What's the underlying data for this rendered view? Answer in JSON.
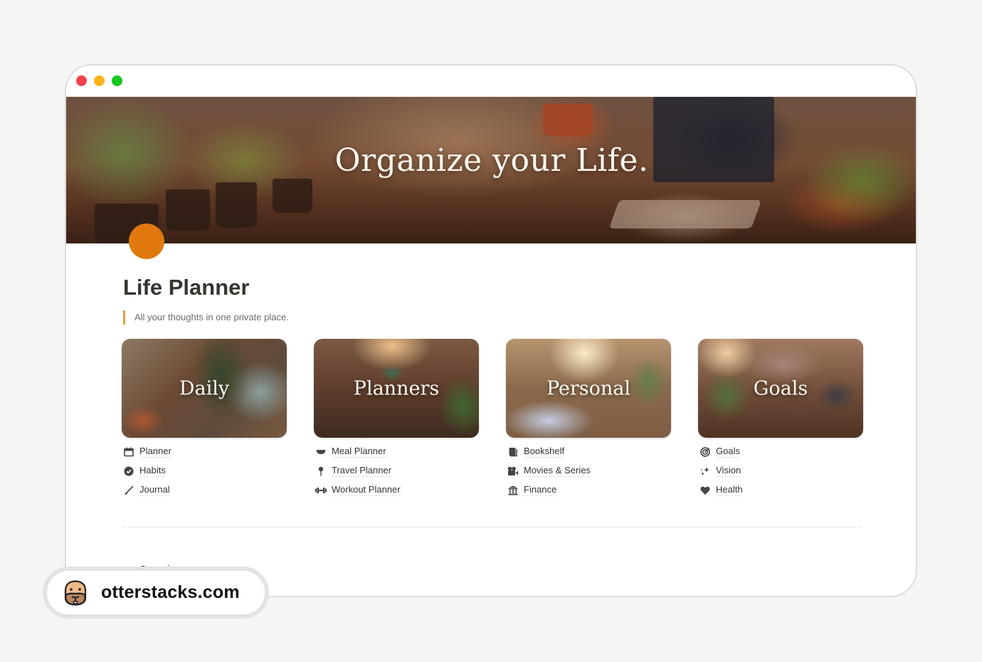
{
  "window": {
    "traffic_lights": [
      "close",
      "minimize",
      "maximize"
    ]
  },
  "banner": {
    "title": "Organize your Life."
  },
  "page": {
    "title": "Life Planner",
    "quote": "All your thoughts in one private place.",
    "icon_color": "#e0780e"
  },
  "sections": [
    {
      "label": "Daily",
      "links": [
        {
          "icon": "calendar-icon",
          "glyph": "▭",
          "label": "Planner"
        },
        {
          "icon": "check-circle-icon",
          "glyph": "✔",
          "label": "Habits"
        },
        {
          "icon": "brush-icon",
          "glyph": "✎",
          "label": "Journal"
        }
      ]
    },
    {
      "label": "Planners",
      "links": [
        {
          "icon": "bowl-icon",
          "glyph": "◡",
          "label": "Meal Planner"
        },
        {
          "icon": "pin-icon",
          "glyph": "⚲",
          "label": "Travel Planner"
        },
        {
          "icon": "dumbbell-icon",
          "glyph": "⊶",
          "label": "Workout Planner"
        }
      ]
    },
    {
      "label": "Personal",
      "links": [
        {
          "icon": "book-icon",
          "glyph": "▮",
          "label": "Bookshelf"
        },
        {
          "icon": "movie-camera-icon",
          "glyph": "🎥",
          "label": "Movies & Series"
        },
        {
          "icon": "bank-icon",
          "glyph": "🏛",
          "label": "Finance"
        }
      ]
    },
    {
      "label": "Goals",
      "links": [
        {
          "icon": "target-icon",
          "glyph": "◎",
          "label": "Goals"
        },
        {
          "icon": "sparkles-icon",
          "glyph": "✦",
          "label": "Vision"
        },
        {
          "icon": "heart-icon",
          "glyph": "♥",
          "label": "Health"
        }
      ]
    }
  ],
  "overview": {
    "label": "Overview"
  },
  "watermark": {
    "site": "otterstacks.com"
  }
}
